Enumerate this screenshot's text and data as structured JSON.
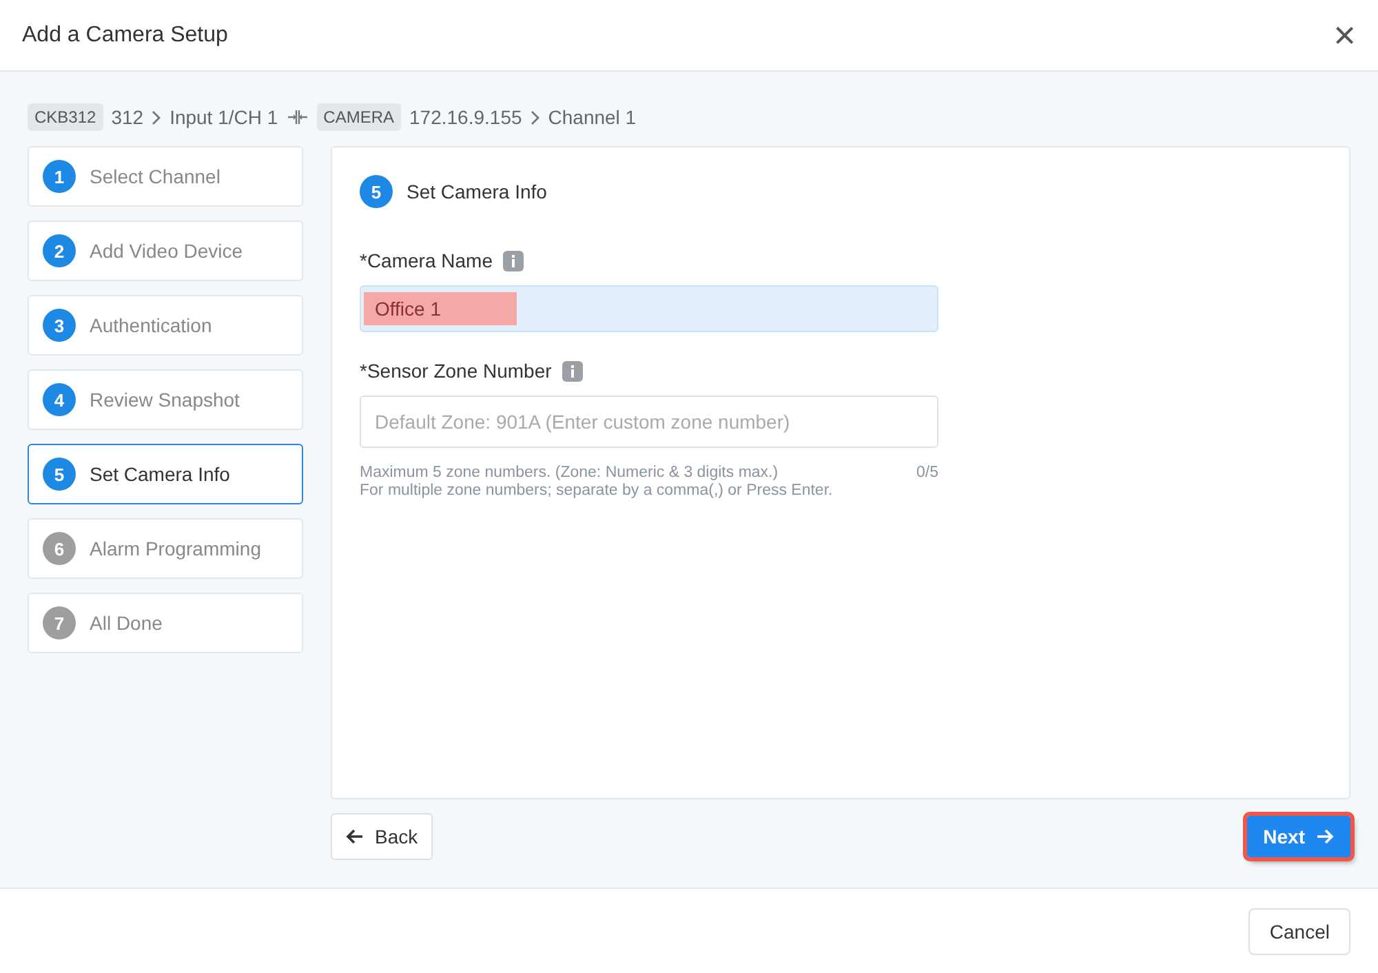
{
  "dialog": {
    "title": "Add a Camera Setup",
    "close": "×"
  },
  "breadcrumb": [
    {
      "kind": "tag",
      "text": "CKB312"
    },
    {
      "kind": "text",
      "text": "312"
    },
    {
      "kind": "chevron"
    },
    {
      "kind": "text",
      "text": "Input 1/CH 1"
    },
    {
      "kind": "link"
    },
    {
      "kind": "tag",
      "text": "CAMERA"
    },
    {
      "kind": "text",
      "text": "172.16.9.155"
    },
    {
      "kind": "chevron"
    },
    {
      "kind": "text",
      "text": "Channel 1"
    }
  ],
  "steps": [
    {
      "number": "1",
      "label": "Select Channel",
      "enabled": true,
      "selected": false
    },
    {
      "number": "2",
      "label": "Add Video Device",
      "enabled": true,
      "selected": false
    },
    {
      "number": "3",
      "label": "Authentication",
      "enabled": true,
      "selected": false
    },
    {
      "number": "4",
      "label": "Review Snapshot",
      "enabled": true,
      "selected": false
    },
    {
      "number": "5",
      "label": "Set Camera Info",
      "enabled": true,
      "selected": true
    },
    {
      "number": "6",
      "label": "Alarm Programming",
      "enabled": false,
      "selected": false
    },
    {
      "number": "7",
      "label": "All Done",
      "enabled": false,
      "selected": false
    }
  ],
  "panel": {
    "step_number": "5",
    "title": "Set Camera Info",
    "fields": [
      {
        "label": "*Camera Name",
        "value": "Office 1",
        "highlighted": true,
        "focused": true
      },
      {
        "label": "*Sensor Zone Number",
        "placeholder": "Default Zone: 901A (Enter custom zone number)",
        "hint": "Maximum 5 zone numbers. (Zone: Numeric & 3 digits max.)",
        "hint_2": "For multiple zone numbers; separate by a comma(,) or Press Enter.",
        "count": "0/5",
        "highlighted": false,
        "focused": false
      }
    ]
  },
  "back_button": "Back",
  "next_button": {
    "label": "Next",
    "highlighted": true
  },
  "cancel_button": "Cancel"
}
